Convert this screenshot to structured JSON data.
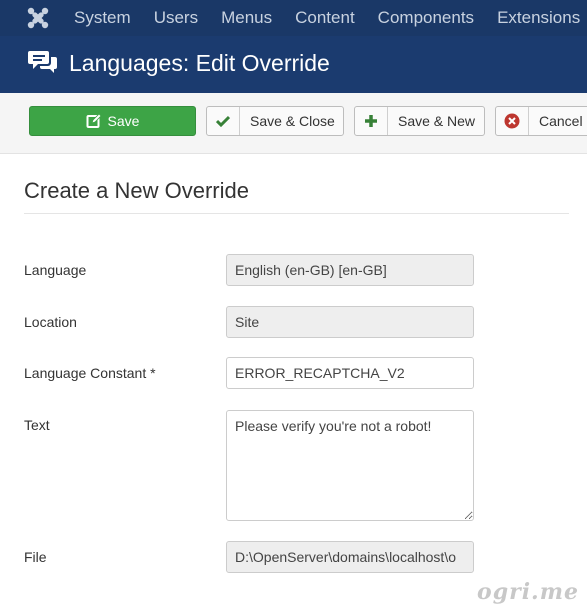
{
  "nav": {
    "items": [
      "System",
      "Users",
      "Menus",
      "Content",
      "Components",
      "Extensions"
    ]
  },
  "header": {
    "title": "Languages: Edit Override",
    "icon": "comments-icon"
  },
  "toolbar": {
    "save": "Save",
    "save_close": "Save & Close",
    "save_new": "Save & New",
    "cancel": "Cancel"
  },
  "form": {
    "heading": "Create a New Override",
    "language_label": "Language",
    "language_value": "English (en-GB) [en-GB]",
    "location_label": "Location",
    "location_value": "Site",
    "constant_label": "Language Constant *",
    "constant_value": "ERROR_RECAPTCHA_V2",
    "text_label": "Text",
    "text_value": "Please verify you're not a robot!",
    "file_label": "File",
    "file_value": "D:\\OpenServer\\domains\\localhost\\o"
  },
  "watermark": "ogri.me",
  "colors": {
    "nav_bg": "#1a3867",
    "title_bg": "#1b3b6f",
    "save_green": "#3da446",
    "cancel_red": "#bd362f",
    "check_green": "#378137"
  }
}
